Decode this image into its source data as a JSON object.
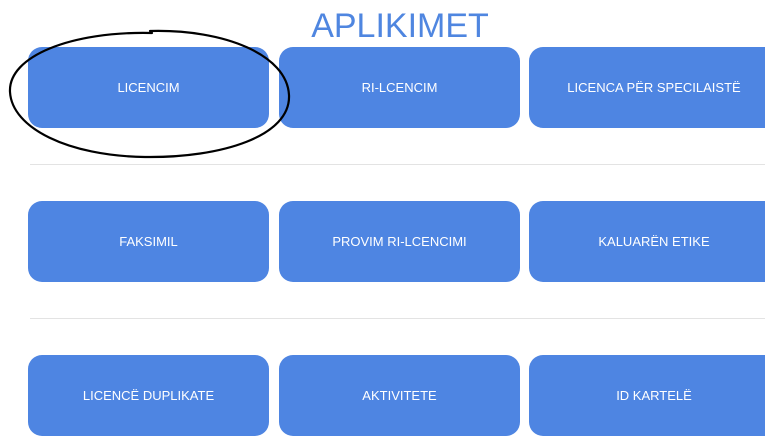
{
  "title": "APLIKIMET",
  "rows": [
    {
      "buttons": [
        {
          "label": "LICENCIM"
        },
        {
          "label": "RI-LCENCIM"
        },
        {
          "label": "LICENCA PËR SPECILAISTË"
        }
      ]
    },
    {
      "buttons": [
        {
          "label": "FAKSIMIL"
        },
        {
          "label": "PROVIM RI-LCENCIMI"
        },
        {
          "label": "KALUARËN ETIKE"
        }
      ]
    },
    {
      "buttons": [
        {
          "label": "LICENCË DUPLIKATE"
        },
        {
          "label": "AKTIVITETE"
        },
        {
          "label": "ID KARTELË"
        }
      ]
    }
  ],
  "colors": {
    "button": "#4e85e2",
    "title": "#4f86e0",
    "divider": "#e3e3e3",
    "annotation": "#000000"
  }
}
